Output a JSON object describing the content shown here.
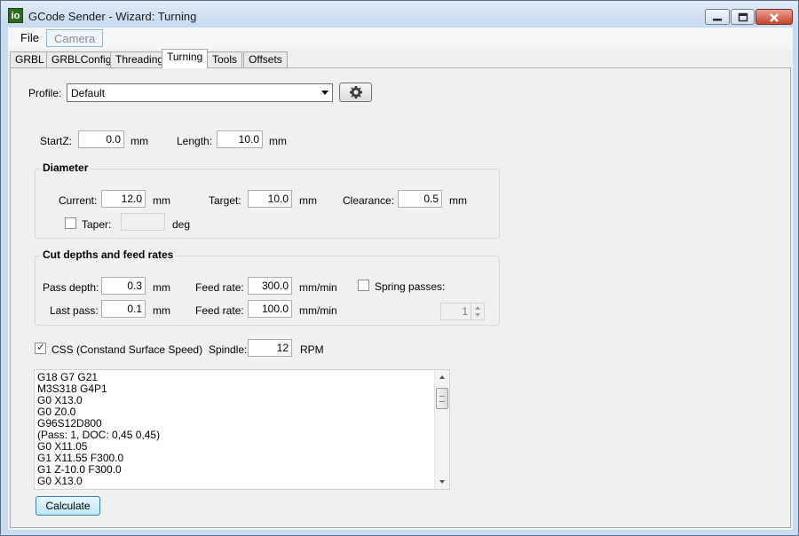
{
  "window": {
    "title": "GCode Sender - Wizard: Turning",
    "icon_text": "io"
  },
  "menu": {
    "file": "File",
    "camera": "Camera"
  },
  "tabs": [
    {
      "label": "GRBL"
    },
    {
      "label": "GRBLConfig"
    },
    {
      "label": "Threading"
    },
    {
      "label": "Turning"
    },
    {
      "label": "Tools"
    },
    {
      "label": "Offsets"
    }
  ],
  "active_tab": "Turning",
  "profile": {
    "label": "Profile:",
    "value": "Default",
    "settings_icon": "gear-icon"
  },
  "startz": {
    "label": "StartZ:",
    "value": "0.0",
    "unit": "mm"
  },
  "length": {
    "label": "Length:",
    "value": "10.0",
    "unit": "mm"
  },
  "diameter": {
    "title": "Diameter",
    "current": {
      "label": "Current:",
      "value": "12.0",
      "unit": "mm"
    },
    "target": {
      "label": "Target:",
      "value": "10.0",
      "unit": "mm"
    },
    "clearance": {
      "label": "Clearance:",
      "value": "0.5",
      "unit": "mm"
    },
    "taper": {
      "label": "Taper:",
      "value": "",
      "unit": "deg",
      "checked": false
    }
  },
  "cut": {
    "title": "Cut depths and feed rates",
    "pass_depth": {
      "label": "Pass depth:",
      "value": "0.3",
      "unit": "mm"
    },
    "feed_rate_1": {
      "label": "Feed rate:",
      "value": "300.0",
      "unit": "mm/min"
    },
    "last_pass": {
      "label": "Last pass:",
      "value": "0.1",
      "unit": "mm"
    },
    "feed_rate_2": {
      "label": "Feed rate:",
      "value": "100.0",
      "unit": "mm/min"
    },
    "spring_passes": {
      "label": "Spring passes:",
      "value": "1",
      "checked": false
    }
  },
  "css": {
    "label": "CSS (Constand Surface Speed)",
    "checked": true
  },
  "spindle": {
    "label": "Spindle:",
    "value": "12",
    "unit": "RPM"
  },
  "gcode_lines": [
    "G18 G7 G21",
    "M3S318 G4P1",
    "G0 X13.0",
    "G0 Z0.0",
    "G96S12D800",
    "(Pass: 1, DOC: 0,45 0,45)",
    "G0 X11.05",
    "G1 X11.55 F300.0",
    "G1 Z-10.0 F300.0",
    "G0 X13.0"
  ],
  "calculate_label": "Calculate",
  "colors": {
    "titlebar": "#c6d9ee",
    "close_button": "#c5442c",
    "accent_check": "#1d3f8c"
  }
}
